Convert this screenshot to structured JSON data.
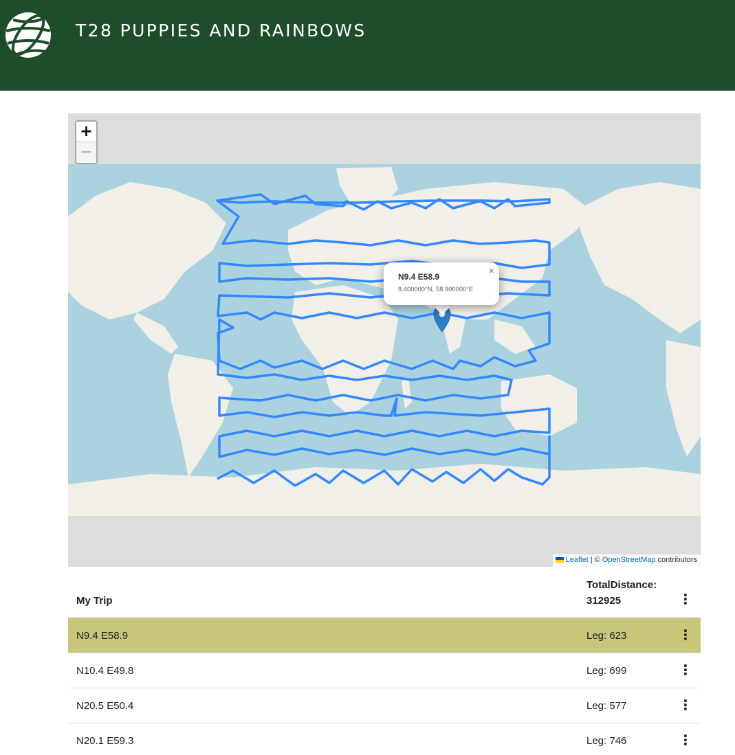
{
  "header": {
    "title": "T28 PUPPIES AND RAINBOWS",
    "logo_icon": "globe-icon"
  },
  "map": {
    "zoom_in_label": "+",
    "zoom_out_label": "−",
    "popup": {
      "title": "N9.4 E58.9",
      "subtitle": "9.400000°N, 58.900000°E",
      "close_label": "×"
    },
    "attribution": {
      "leaflet": "Leaflet",
      "separator": " | © ",
      "osm": "OpenStreetMap",
      "suffix": " contributors"
    },
    "route_color": "#3388ff",
    "marker_color": "#2a81cb"
  },
  "trip": {
    "name": "My Trip",
    "total_label": "TotalDistance:",
    "total_value": "312925",
    "menu_icon": "more-vert-icon",
    "rows": [
      {
        "place": "N9.4 E58.9",
        "leg": "Leg: 623"
      },
      {
        "place": "N10.4 E49.8",
        "leg": "Leg: 699"
      },
      {
        "place": "N20.5 E50.4",
        "leg": "Leg: 577"
      },
      {
        "place": "N20.1 E59.3",
        "leg": "Leg: 746"
      }
    ]
  }
}
